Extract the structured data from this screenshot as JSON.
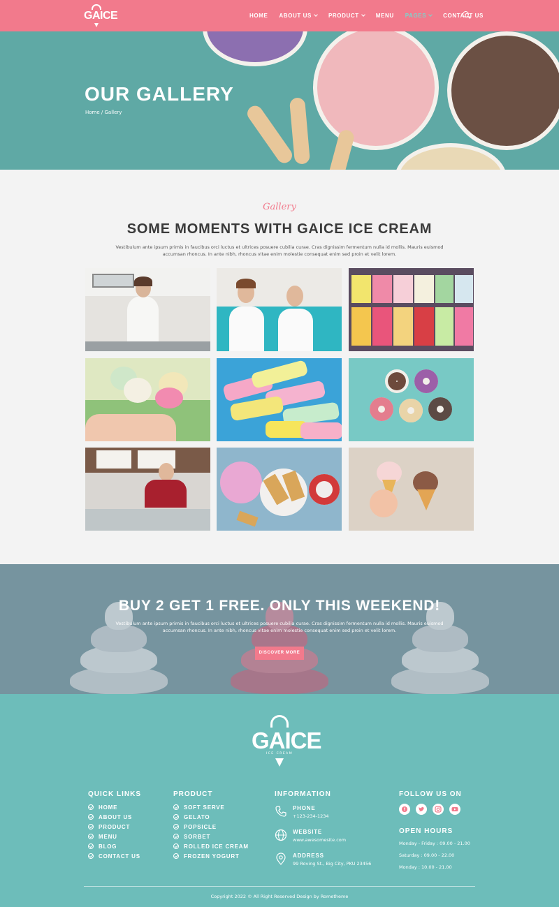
{
  "nav": {
    "logo_text": "GAICE",
    "items": [
      {
        "label": "HOME",
        "dropdown": false,
        "active": false
      },
      {
        "label": "ABOUT US",
        "dropdown": true,
        "active": false
      },
      {
        "label": "PRODUCT",
        "dropdown": true,
        "active": false
      },
      {
        "label": "MENU",
        "dropdown": false,
        "active": false
      },
      {
        "label": "PAGES",
        "dropdown": true,
        "active": true
      },
      {
        "label": "CONTACT US",
        "dropdown": false,
        "active": false
      }
    ],
    "search_icon": "search-icon"
  },
  "hero": {
    "title": "OUR GALLERY",
    "breadcrumb": "Home / Gallery"
  },
  "gallery": {
    "script_label": "Gallery",
    "title": "SOME MOMENTS WITH GAICE ICE CREAM",
    "description": "Vestibulum ante ipsum primis in faucibus orci luctus et ultrices posuere cubilia curae. Cras dignissim fermentum nulla id mollis. Mauris euismod accumsan rhoncus. In ante nibh, rhoncus vitae enim molestie consequat enim sed proin et velit lorem."
  },
  "promo": {
    "title": "BUY 2 GET 1 FREE. ONLY THIS WEEKEND!",
    "description": "Vestibulum ante ipsum primis in faucibus orci luctus et ultrices posuere cubilia curae. Cras dignissim fermentum nulla id mollis. Mauris euismod accumsan rhoncus. In ante nibh, rhoncus vitae enim molestie consequat enim sed proin et velit lorem.",
    "button": "DISCOVER MORE"
  },
  "footer": {
    "logo_text": "GAICE",
    "logo_sub": "ICE CREAM",
    "quick_links": {
      "title": "QUICK LINKS",
      "items": [
        "HOME",
        "ABOUT US",
        "PRODUCT",
        "MENU",
        "BLOG",
        "CONTACT US"
      ]
    },
    "product": {
      "title": "PRODUCT",
      "items": [
        "SOFT SERVE",
        "GELATO",
        "POPSICLE",
        "SORBET",
        "ROLLED ICE CREAM",
        "FROZEN YOGURT"
      ]
    },
    "information": {
      "title": "INFORMATION",
      "phone_label": "PHONE",
      "phone": "+123-234-1234",
      "website_label": "WEBSITE",
      "website": "www.awesomesite.com",
      "address_label": "ADDRESS",
      "address": "99 Roving St., Big City, PKU 23456"
    },
    "follow": {
      "title": "FOLLOW US ON",
      "icons": [
        "facebook-icon",
        "twitter-icon",
        "instagram-icon",
        "youtube-icon"
      ]
    },
    "hours": {
      "title": "OPEN HOURS",
      "lines": [
        "Monday - Friday : 09.00 - 21.00",
        "Saturday : 09.00 - 22.00",
        "Monday : 10.00 - 21.00"
      ]
    },
    "copyright": "Copyright 2022 © All Right Reserved Design by Rometheme"
  },
  "colors": {
    "brand_pink": "#f27a8c",
    "teal": "#6dbdba",
    "active_nav": "#7ed3cc"
  }
}
